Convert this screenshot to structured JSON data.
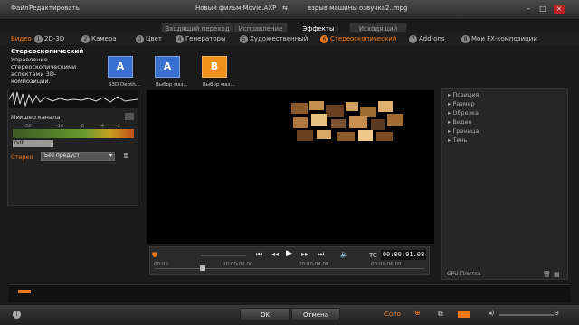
{
  "menu": {
    "file": "Файл",
    "edit": "Редактировать"
  },
  "window": {
    "title": "Новый фильм.Movie.AXP",
    "project": "взрыв машины озвучка2..mpg"
  },
  "mode_tabs": [
    "Входящий переход",
    "Исправление",
    "Эффекты",
    "Исходящий переход"
  ],
  "categories": [
    {
      "label": "Видео",
      "num": ""
    },
    {
      "label": "2D-3D",
      "num": "1"
    },
    {
      "label": "Камера",
      "num": "2"
    },
    {
      "label": "Цвет",
      "num": "3"
    },
    {
      "label": "Генераторы",
      "num": "4"
    },
    {
      "label": "Художественный",
      "num": "5"
    },
    {
      "label": "Стереоскопический",
      "num": "6"
    },
    {
      "label": "Add-ons",
      "num": "7"
    },
    {
      "label": "Мои FX-композиции",
      "num": "8"
    }
  ],
  "effect_desc": {
    "title": "Стереоскопический",
    "text": "Управление стереоскопическими аспектами 3D-композиции."
  },
  "effects": [
    {
      "letter": "A",
      "label": "S3D Depth..."
    },
    {
      "letter": "A",
      "label": "Выбор маз..."
    },
    {
      "letter": "B",
      "label": "Выбор маз..."
    }
  ],
  "mixer": {
    "label": "Микшер канала",
    "db": "0dB",
    "scale": [
      "-32",
      "-16",
      "-8",
      "-4",
      "-2"
    ],
    "stereo": "Стерео",
    "preset": "Без предуст"
  },
  "properties": [
    "Позиция",
    "Размер",
    "Обрезка",
    "Видео",
    "Граница",
    "Тень"
  ],
  "gpu": "GPU Плитка",
  "transport": {
    "tc_label": "TC",
    "tc_value": "00:00:01.08",
    "ticks": [
      "00:00",
      "00:00:02.00",
      "00:00:04.00",
      "00:00:06.00"
    ]
  },
  "footer": {
    "ok": "OK",
    "cancel": "Отмена",
    "solo": "Соло"
  },
  "colors": {
    "accent": "#f07a1a",
    "thumb_a": "#3a70d0",
    "thumb_b": "#f0901a"
  }
}
